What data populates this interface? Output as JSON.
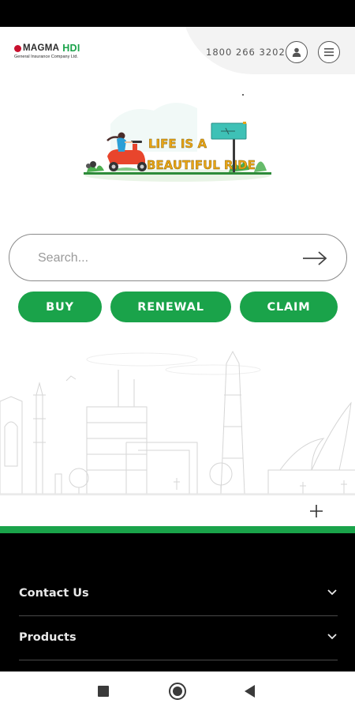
{
  "header": {
    "logo_brand": "MAGMA",
    "logo_brand_accent": "HDI",
    "logo_tagline": "General Insurance Company Ltd.",
    "phone": "1800 266 3202",
    "icons": {
      "user": "user-icon",
      "menu": "menu-icon"
    }
  },
  "hero": {
    "headline_line1": "LIFE IS A",
    "headline_line2": "BEAUTIFUL RIDE"
  },
  "search": {
    "placeholder": "Search...",
    "value": "",
    "icon": "arrow-right-icon"
  },
  "actions": [
    {
      "label": "BUY"
    },
    {
      "label": "RENEWAL"
    },
    {
      "label": "CLAIM"
    }
  ],
  "expand": {
    "icon": "plus-icon"
  },
  "footer": {
    "items": [
      {
        "label": "Contact Us",
        "icon": "chevron-down-icon"
      },
      {
        "label": "Products",
        "icon": "chevron-down-icon"
      }
    ]
  },
  "nav": {
    "back": "square-icon",
    "home": "home-circle-icon",
    "recents": "back-triangle-icon"
  },
  "colors": {
    "brand_green": "#1aa34a",
    "brand_red": "#c8102e",
    "footer_bg": "#000000"
  }
}
